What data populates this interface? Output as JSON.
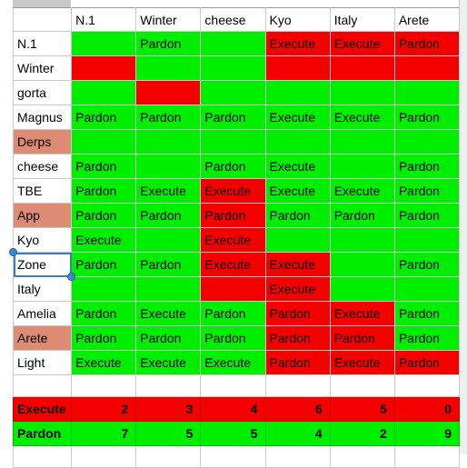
{
  "app": {
    "type": "spreadsheet-vote-matrix"
  },
  "grid": {
    "corner_label": "",
    "columns": [
      "N.1",
      "Winter",
      "cheese",
      "Kyo",
      "Italy",
      "Arete"
    ],
    "rows": [
      {
        "label": "N.1",
        "label_fill": "white",
        "cells": [
          {
            "text": "",
            "fill": "green"
          },
          {
            "text": "Pardon",
            "fill": "green"
          },
          {
            "text": "",
            "fill": "green"
          },
          {
            "text": "Execute",
            "fill": "red"
          },
          {
            "text": "Execute",
            "fill": "red"
          },
          {
            "text": "Pardon",
            "fill": "red"
          }
        ]
      },
      {
        "label": "Winter",
        "label_fill": "white",
        "cells": [
          {
            "text": "",
            "fill": "red"
          },
          {
            "text": "",
            "fill": "green"
          },
          {
            "text": "",
            "fill": "green"
          },
          {
            "text": "",
            "fill": "red"
          },
          {
            "text": "",
            "fill": "red"
          },
          {
            "text": "",
            "fill": "red"
          }
        ]
      },
      {
        "label": "gorta",
        "label_fill": "white",
        "cells": [
          {
            "text": "",
            "fill": "green"
          },
          {
            "text": "",
            "fill": "red"
          },
          {
            "text": "",
            "fill": "green"
          },
          {
            "text": "",
            "fill": "green"
          },
          {
            "text": "",
            "fill": "green"
          },
          {
            "text": "",
            "fill": "green"
          }
        ]
      },
      {
        "label": "Magnus",
        "label_fill": "white",
        "cells": [
          {
            "text": "Pardon",
            "fill": "green"
          },
          {
            "text": "Pardon",
            "fill": "green"
          },
          {
            "text": "Pardon",
            "fill": "green"
          },
          {
            "text": "Execute",
            "fill": "green"
          },
          {
            "text": "Execute",
            "fill": "green"
          },
          {
            "text": "Pardon",
            "fill": "green"
          }
        ]
      },
      {
        "label": "Derps",
        "label_fill": "salmon",
        "cells": [
          {
            "text": "",
            "fill": "green"
          },
          {
            "text": "",
            "fill": "green"
          },
          {
            "text": "",
            "fill": "green"
          },
          {
            "text": "",
            "fill": "green"
          },
          {
            "text": "",
            "fill": "green"
          },
          {
            "text": "",
            "fill": "green"
          }
        ]
      },
      {
        "label": "cheese",
        "label_fill": "white",
        "cells": [
          {
            "text": "Pardon",
            "fill": "green"
          },
          {
            "text": "",
            "fill": "green"
          },
          {
            "text": "Pardon",
            "fill": "green"
          },
          {
            "text": "Execute",
            "fill": "green"
          },
          {
            "text": "",
            "fill": "green"
          },
          {
            "text": "Pardon",
            "fill": "green"
          }
        ]
      },
      {
        "label": "TBE",
        "label_fill": "white",
        "cells": [
          {
            "text": "Pardon",
            "fill": "green"
          },
          {
            "text": "Execute",
            "fill": "green"
          },
          {
            "text": "Execute",
            "fill": "red"
          },
          {
            "text": "Execute",
            "fill": "green"
          },
          {
            "text": "Execute",
            "fill": "green"
          },
          {
            "text": "Pardon",
            "fill": "green"
          }
        ]
      },
      {
        "label": "App",
        "label_fill": "salmon",
        "cells": [
          {
            "text": "Pardon",
            "fill": "green"
          },
          {
            "text": "Pardon",
            "fill": "green"
          },
          {
            "text": "Pardon",
            "fill": "red"
          },
          {
            "text": "Pardon",
            "fill": "green"
          },
          {
            "text": "Pardon",
            "fill": "green"
          },
          {
            "text": "Pardon",
            "fill": "green"
          }
        ]
      },
      {
        "label": "Kyo",
        "label_fill": "white",
        "cells": [
          {
            "text": "Execute",
            "fill": "green"
          },
          {
            "text": "",
            "fill": "green"
          },
          {
            "text": "Execute",
            "fill": "red"
          },
          {
            "text": "",
            "fill": "green"
          },
          {
            "text": "",
            "fill": "green"
          },
          {
            "text": "",
            "fill": "green"
          }
        ]
      },
      {
        "label": "Zone",
        "label_fill": "white",
        "selected": true,
        "cells": [
          {
            "text": "Pardon",
            "fill": "green"
          },
          {
            "text": "Pardon",
            "fill": "green"
          },
          {
            "text": "Execute",
            "fill": "red"
          },
          {
            "text": "Execute",
            "fill": "red"
          },
          {
            "text": "",
            "fill": "green"
          },
          {
            "text": "Pardon",
            "fill": "green"
          }
        ]
      },
      {
        "label": "Italy",
        "label_fill": "white",
        "cells": [
          {
            "text": "",
            "fill": "green"
          },
          {
            "text": "",
            "fill": "green"
          },
          {
            "text": "",
            "fill": "red"
          },
          {
            "text": "Execute",
            "fill": "red"
          },
          {
            "text": "",
            "fill": "green"
          },
          {
            "text": "",
            "fill": "green"
          }
        ]
      },
      {
        "label": "Amelia",
        "label_fill": "white",
        "cells": [
          {
            "text": "Pardon",
            "fill": "green"
          },
          {
            "text": "Execute",
            "fill": "green"
          },
          {
            "text": "Pardon",
            "fill": "green"
          },
          {
            "text": "Pardon",
            "fill": "red"
          },
          {
            "text": "Execute",
            "fill": "red"
          },
          {
            "text": "Pardon",
            "fill": "green"
          }
        ]
      },
      {
        "label": "Arete",
        "label_fill": "salmon",
        "cells": [
          {
            "text": "Pardon",
            "fill": "green"
          },
          {
            "text": "Pardon",
            "fill": "green"
          },
          {
            "text": "Pardon",
            "fill": "green"
          },
          {
            "text": "Pardon",
            "fill": "red"
          },
          {
            "text": "Pardon",
            "fill": "red"
          },
          {
            "text": "Pardon",
            "fill": "green"
          }
        ]
      },
      {
        "label": "Light",
        "label_fill": "white",
        "cells": [
          {
            "text": "Execute",
            "fill": "green"
          },
          {
            "text": "Execute",
            "fill": "green"
          },
          {
            "text": "Execute",
            "fill": "green"
          },
          {
            "text": "Pardon",
            "fill": "red"
          },
          {
            "text": "Execute",
            "fill": "red"
          },
          {
            "text": "Pardon",
            "fill": "red"
          }
        ]
      }
    ],
    "summary": [
      {
        "label": "Execute",
        "fill": "red",
        "values": [
          "2",
          "3",
          "4",
          "6",
          "5",
          "0"
        ]
      },
      {
        "label": "Pardon",
        "fill": "green",
        "values": [
          "7",
          "5",
          "5",
          "4",
          "2",
          "9"
        ]
      }
    ]
  },
  "colors": {
    "green": "#00ee00",
    "red": "#f40000",
    "salmon": "#de8b73",
    "selection": "#3b78c8",
    "gridline": "#c9c9c9"
  },
  "selection": {
    "cell_label": "Zone"
  }
}
